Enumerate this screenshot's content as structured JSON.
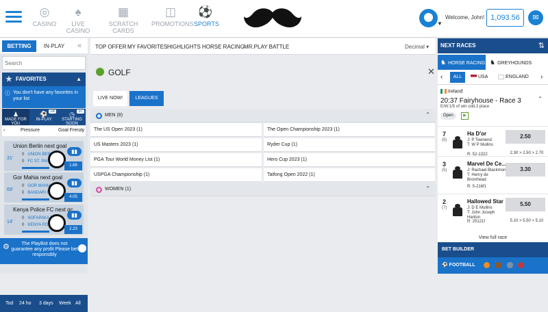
{
  "nav": {
    "casino": "CASINO",
    "live_casino": "LIVE CASINO",
    "scratch": "SCRATCH CARDS",
    "promotions": "PROMOTIONS",
    "sports": "SPORTS"
  },
  "user": {
    "welcome": "Welcome, John!",
    "balance": "1,093.56"
  },
  "left": {
    "tab_betting": "BETTING",
    "tab_inplay": "IN-PLAY",
    "search_placeholder": "Search",
    "favorites_title": "FAVORITES",
    "favorites_msg": "You don't have any favorites in your list",
    "tabs": [
      {
        "label": "MADE FOR YOU",
        "count": ""
      },
      {
        "label": "IN-PLAY",
        "count": "24"
      },
      {
        "label": "STARTING SOON",
        "count": "37"
      }
    ],
    "filter": {
      "a": "Pressure",
      "b": "Goal Frenzy"
    },
    "cards": [
      {
        "title": "Union Berlin next goal",
        "minute": "31'",
        "home": "UNION BERLIN",
        "away": "FC ST. PAULI",
        "h": "0",
        "a": "0",
        "odd": "1.66"
      },
      {
        "title": "Gor Mahia next goal",
        "minute": "69'",
        "home": "GOR MAHIA F",
        "away": "BANDARI FC",
        "h": "0",
        "a": "0",
        "odd": "4.05"
      },
      {
        "title": "Kenya Police FC next gc",
        "minute": "14'",
        "home": "SOFAPAKA FC",
        "away": "KENYA POLICE",
        "h": "0",
        "a": "0",
        "odd": "2.23"
      }
    ],
    "playbot": "The PlayBot does not guarantee any profit Please bet responsibly",
    "time_filters": [
      "Tod",
      "24 ho",
      "3 days",
      "Week",
      "All"
    ]
  },
  "main": {
    "tabs": [
      "TOP OFFER",
      "MY FAVORITES",
      "HIGHLIGHTS",
      "HORSE RACING",
      "MR.PLAY BATTLE"
    ],
    "odds_format": "Decimal",
    "sport_title": "GOLF",
    "sub_live": "LIVE NOW!",
    "sub_leagues": "LEAGUES",
    "men_label": "MEN (8)",
    "women_label": "WOMEN (1)",
    "leagues": [
      "The US Open 2023  (1)",
      "The Open Championship 2023  (1)",
      "US Masters 2023  (1)",
      "Ryder Cup  (1)",
      "PGA Tour World Money List  (1)",
      "Hero Cup 2023  (1)",
      "USPGA Championship  (1)",
      "Taifong Open 2022  (1)"
    ]
  },
  "right": {
    "next_races": "NEXT RACES",
    "horse_racing": "HORSE RACING",
    "greyhounds": "GREYHOUNDS",
    "all": "ALL",
    "usa": "USA",
    "england": "ENGLAND",
    "country": "Ireland",
    "race_title": "20:37 Fairyhouse - Race 3",
    "ew": "E/W:1/5 of win odd,3 place",
    "status": "Open",
    "runners": [
      {
        "num": "7",
        "draw": "(5)",
        "name": "Ha D'or",
        "j": "J: P Townend",
        "t": "T: W P Mullins",
        "r": "R: 52-1322",
        "odd": "2.50",
        "prev": "2.30 > 2.50 > 2.70"
      },
      {
        "num": "3",
        "draw": "(5)",
        "name": "Marvel De Ce...",
        "j": "J: Rachael Blackmore",
        "t": "T: Henry de Bromhead",
        "r": "R: 5-216f1",
        "odd": "3.30",
        "prev": ""
      },
      {
        "num": "2",
        "draw": "(7)",
        "name": "Hallowed Star",
        "j": "J: D E Mullins",
        "t": "T: John Joseph Hanlon",
        "r": "R: 25121f",
        "odd": "5.50",
        "prev": "5.10 > 5.50 > 5.10"
      }
    ],
    "view_full": "View full race",
    "bet_builder": "BET BUILDER",
    "football": "FOOTBALL"
  }
}
